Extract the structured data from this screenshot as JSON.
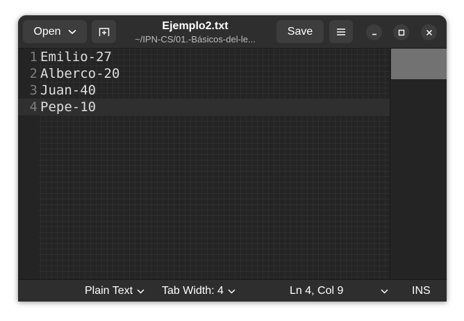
{
  "header": {
    "open_label": "Open",
    "title": "Ejemplo2.txt",
    "subtitle": "~/IPN-CS/01.-Básicos-del-le...",
    "save_label": "Save"
  },
  "editor": {
    "lines": [
      {
        "number": "1",
        "text": "Emilio-27"
      },
      {
        "number": "2",
        "text": "Alberco-20"
      },
      {
        "number": "3",
        "text": "Juan-40"
      },
      {
        "number": "4",
        "text": "Pepe-10"
      }
    ],
    "current_line": 4
  },
  "statusbar": {
    "language": "Plain Text",
    "tab_width": "Tab Width: 4",
    "position": "Ln 4, Col 9",
    "mode": "INS"
  },
  "colors": {
    "window_bg": "#242424",
    "headerbar_bg": "#2e2e2e",
    "button_bg": "#3d3d3d",
    "text": "#dedede",
    "line_number": "#7d7d7d"
  },
  "icons": {
    "new_tab": "tab-new-icon",
    "menu": "hamburger-menu-icon",
    "minimize": "minimize-icon",
    "maximize": "maximize-icon",
    "close": "close-icon",
    "dropdown": "chevron-down-icon"
  }
}
